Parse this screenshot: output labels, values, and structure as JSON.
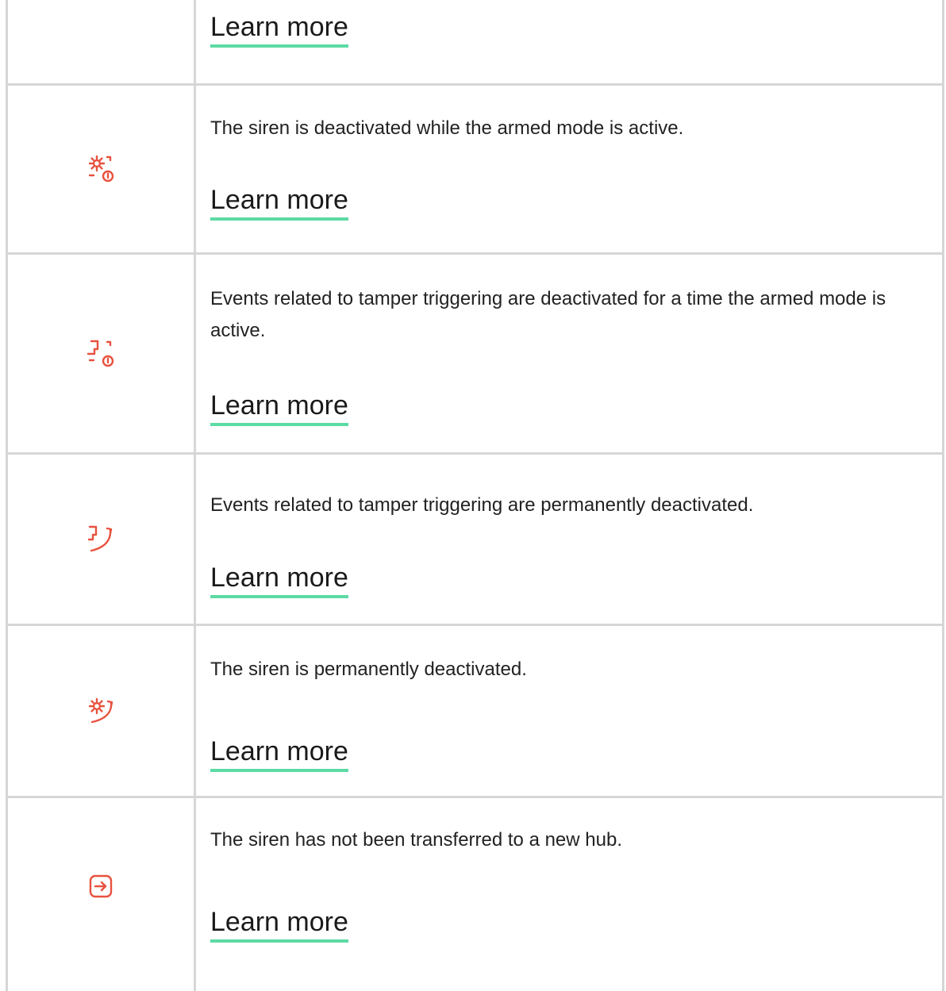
{
  "rows": [
    {
      "description": "",
      "link": "Learn more",
      "icon": ""
    },
    {
      "description": "The siren is deactivated while the armed mode is active.",
      "link": "Learn more",
      "icon": "siren-deactivated-armed-icon"
    },
    {
      "description": "Events related to tamper triggering are deactivated for a time the armed mode is active.",
      "link": "Learn more",
      "icon": "tamper-deactivated-armed-icon"
    },
    {
      "description": "Events related to tamper triggering are permanently deactivated.",
      "link": "Learn more",
      "icon": "tamper-deactivated-permanent-icon"
    },
    {
      "description": "The siren is permanently deactivated.",
      "link": "Learn more",
      "icon": "siren-deactivated-permanent-icon"
    },
    {
      "description": "The siren has not been transferred to a new hub.",
      "link": "Learn more",
      "icon": "transfer-icon"
    }
  ],
  "colors": {
    "icon": "#e8523f",
    "link_underline": "#5cdba4",
    "border": "#d6d6d6"
  }
}
